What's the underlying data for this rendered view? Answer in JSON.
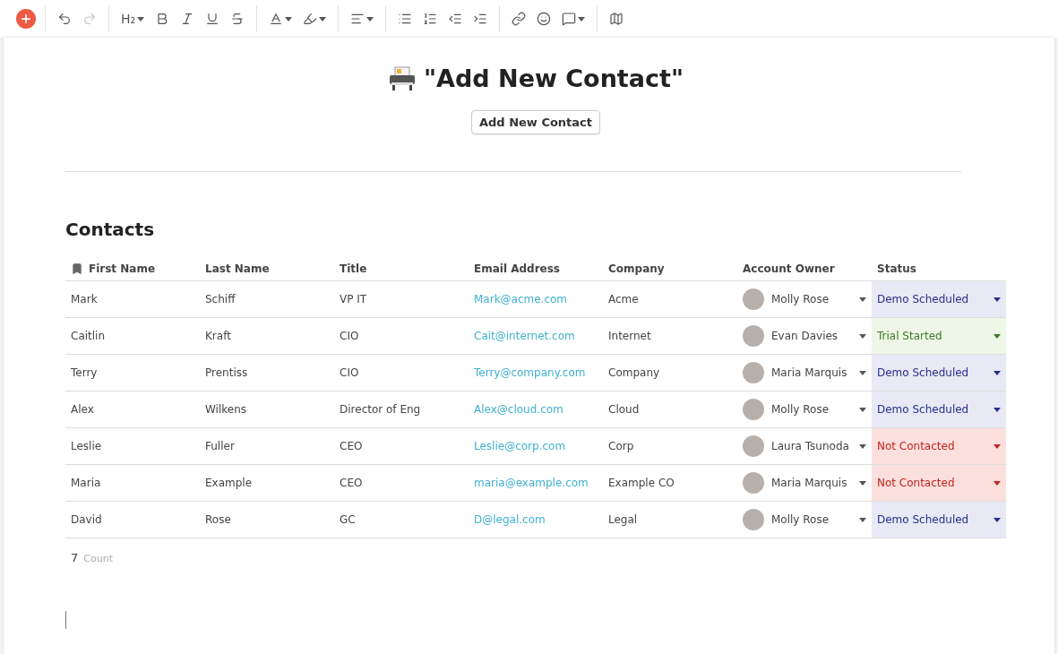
{
  "toolbar": {
    "groups": [
      {
        "items": [
          {
            "kind": "add"
          }
        ]
      },
      {
        "items": [
          {
            "kind": "undo",
            "disabled": false
          },
          {
            "kind": "redo",
            "disabled": true
          }
        ]
      },
      {
        "items": [
          {
            "kind": "heading",
            "label": "H₂",
            "dropdown": true
          },
          {
            "kind": "bold"
          },
          {
            "kind": "italic"
          },
          {
            "kind": "underline"
          },
          {
            "kind": "strike"
          }
        ]
      },
      {
        "items": [
          {
            "kind": "text-color",
            "dropdown": true
          },
          {
            "kind": "highlight",
            "dropdown": true
          }
        ]
      },
      {
        "items": [
          {
            "kind": "align",
            "dropdown": true
          }
        ]
      },
      {
        "items": [
          {
            "kind": "bullets"
          },
          {
            "kind": "numbers"
          },
          {
            "kind": "outdent"
          },
          {
            "kind": "indent"
          }
        ]
      },
      {
        "items": [
          {
            "kind": "link"
          },
          {
            "kind": "emoji"
          },
          {
            "kind": "comment",
            "dropdown": true
          }
        ]
      },
      {
        "items": [
          {
            "kind": "map"
          }
        ]
      }
    ]
  },
  "document": {
    "title": "\"Add New Contact\"",
    "button": "Add New Contact",
    "table": {
      "heading": "Contacts",
      "columns": [
        "First Name",
        "Last Name",
        "Title",
        "Email Address",
        "Company",
        "Account Owner",
        "Status"
      ],
      "rows": [
        {
          "first": "Mark",
          "last": "Schiff",
          "title": "VP IT",
          "email": "Mark@acme.com",
          "company": "Acme",
          "owner": "Molly Rose",
          "status": {
            "label": "Demo Scheduled",
            "kind": "demo"
          }
        },
        {
          "first": "Caitlin",
          "last": "Kraft",
          "title": "CIO",
          "email": "Cait@internet.com",
          "company": "Internet",
          "owner": "Evan Davies",
          "status": {
            "label": "Trial Started",
            "kind": "trial"
          }
        },
        {
          "first": "Terry",
          "last": "Prentiss",
          "title": "CIO",
          "email": "Terry@company.com",
          "company": "Company",
          "owner": "Maria Marquis",
          "status": {
            "label": "Demo Scheduled",
            "kind": "demo"
          }
        },
        {
          "first": "Alex",
          "last": "Wilkens",
          "title": "Director of Eng",
          "email": "Alex@cloud.com",
          "company": "Cloud",
          "owner": "Molly Rose",
          "status": {
            "label": "Demo Scheduled",
            "kind": "demo"
          }
        },
        {
          "first": "Leslie",
          "last": "Fuller",
          "title": "CEO",
          "email": "Leslie@corp.com",
          "company": "Corp",
          "owner": "Laura Tsunoda",
          "status": {
            "label": "Not Contacted",
            "kind": "not-contacted"
          }
        },
        {
          "first": "Maria",
          "last": "Example",
          "title": "CEO",
          "email": "maria@example.com",
          "company": "Example CO",
          "owner": "Maria Marquis",
          "status": {
            "label": "Not Contacted",
            "kind": "not-contacted"
          }
        },
        {
          "first": "David",
          "last": "Rose",
          "title": "GC",
          "email": "D@legal.com",
          "company": "Legal",
          "owner": "Molly Rose",
          "status": {
            "label": "Demo Scheduled",
            "kind": "demo"
          }
        }
      ],
      "count": "7",
      "count_label": "Count"
    }
  }
}
